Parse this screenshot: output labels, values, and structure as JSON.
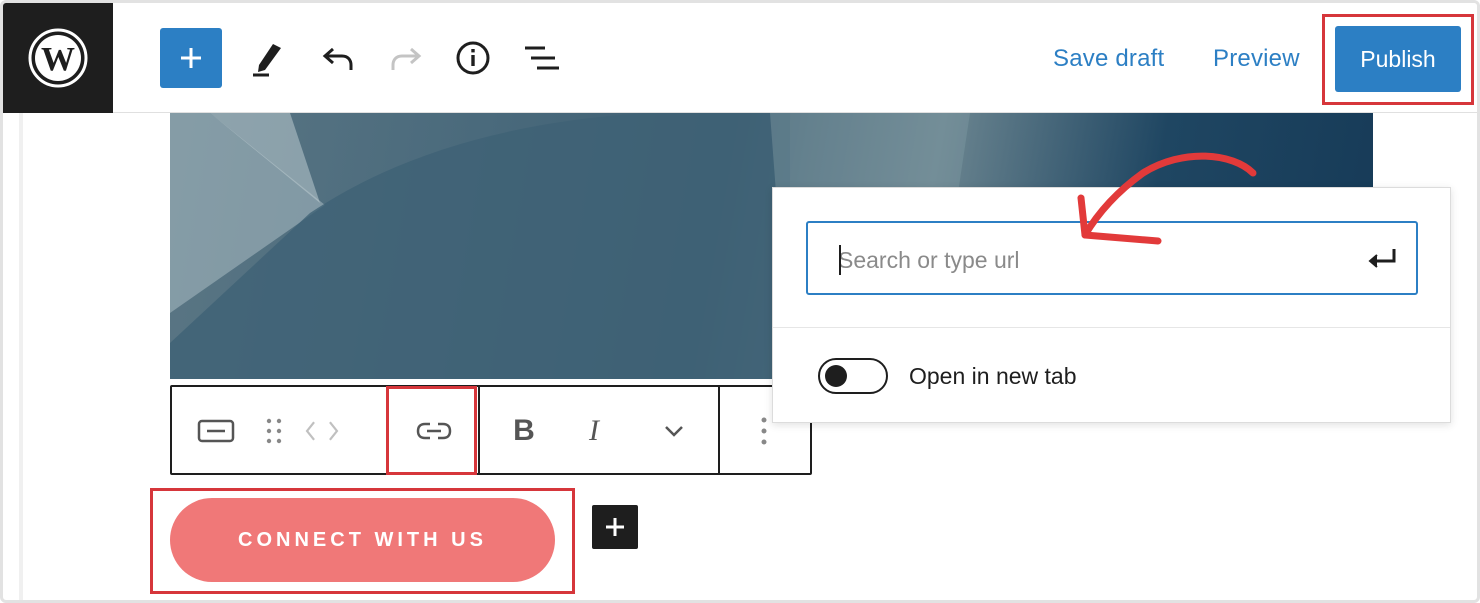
{
  "toolbar": {
    "save_draft": "Save draft",
    "preview": "Preview",
    "publish": "Publish"
  },
  "icons": {
    "logo": "wordpress-logo",
    "add": "plus-icon",
    "tools": "pencil-icon",
    "undo": "undo-icon",
    "redo": "redo-icon",
    "info": "info-icon",
    "outline": "list-view-icon"
  },
  "block_toolbar": {
    "bold": "B",
    "italic": "I"
  },
  "button_block": {
    "label": "CONNECT WITH US"
  },
  "link_popover": {
    "placeholder": "Search or type url",
    "toggle_label": "Open in new tab",
    "toggle_on": false
  },
  "colors": {
    "accent": "#2c7fc4",
    "highlight": "#d6363b",
    "button": "#f07878",
    "dark": "#1e1e1e"
  }
}
